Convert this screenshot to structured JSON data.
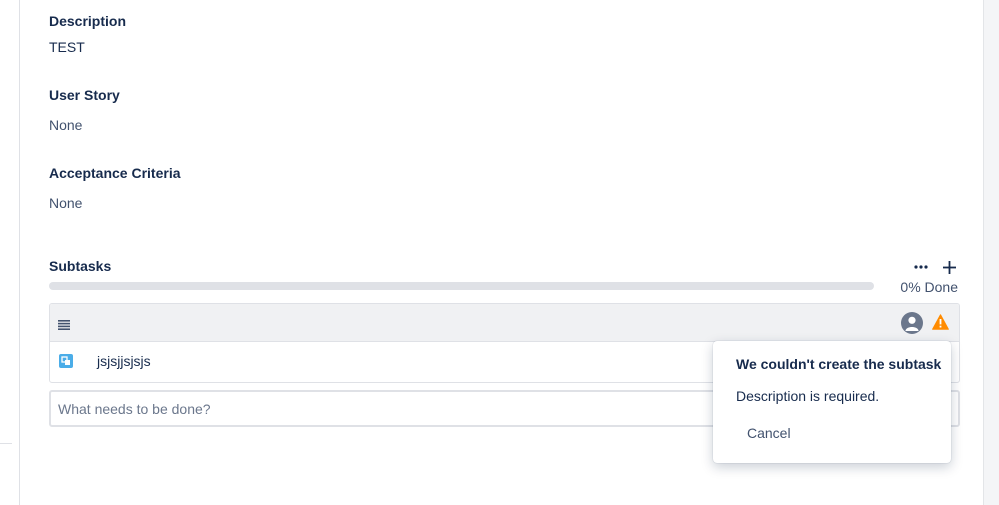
{
  "fields": [
    {
      "label": "Description",
      "value": "TEST"
    },
    {
      "label": "User Story",
      "value": "None"
    },
    {
      "label": "Acceptance Criteria",
      "value": "None"
    }
  ],
  "subtasks": {
    "title": "Subtasks",
    "more_icon": "more-horizontal-icon",
    "add_icon": "plus-icon",
    "progress_percent": 0,
    "progress_text": "0% Done",
    "items": [
      {
        "name": "jsjsjjsjsjs",
        "icon": "subtask-icon"
      }
    ],
    "new_task_placeholder": "What needs to be done?",
    "new_task_value": ""
  },
  "error_popover": {
    "title": "We couldn't create the subtask",
    "message": "Description is required.",
    "cancel_label": "Cancel"
  },
  "colors": {
    "text": "#172b4d",
    "muted": "#42526e",
    "warning": "#ff8b00",
    "subtask_icon": "#4bade8",
    "progress_track": "#dfe1e6"
  }
}
